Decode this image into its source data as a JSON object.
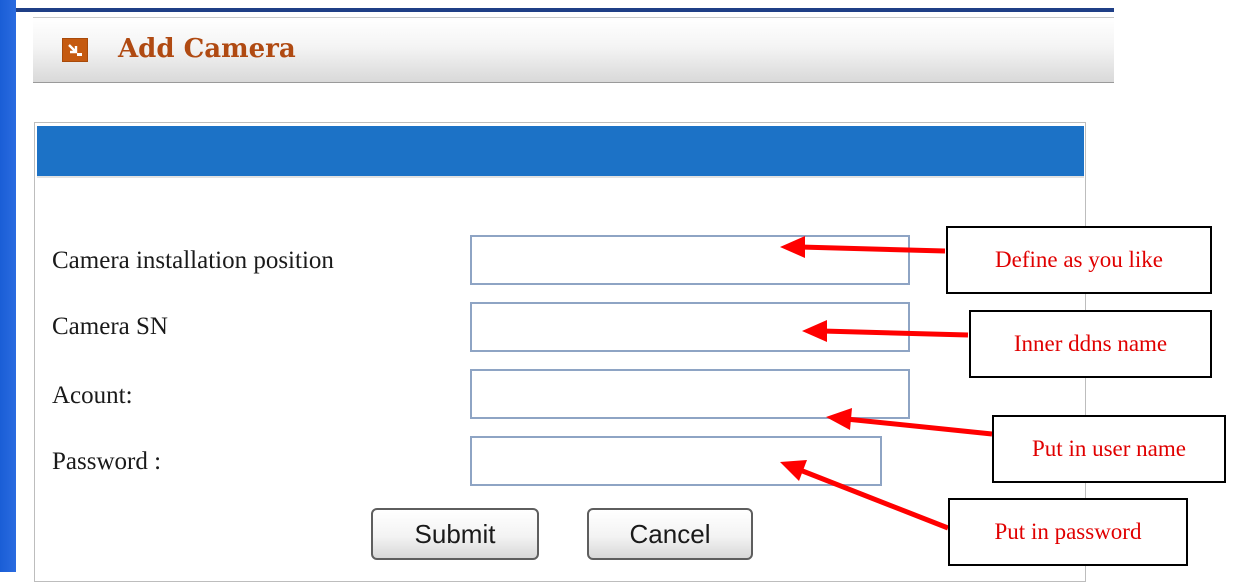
{
  "header": {
    "title": "Add Camera",
    "icon": "arrow-down-right-icon"
  },
  "form": {
    "fields": [
      {
        "label": "Camera installation position",
        "value": ""
      },
      {
        "label": "Camera SN",
        "value": ""
      },
      {
        "label": "Acount:",
        "value": ""
      },
      {
        "label": "Password :",
        "value": ""
      }
    ],
    "submit_label": "Submit",
    "cancel_label": "Cancel"
  },
  "annotations": [
    {
      "text": "Define as you like"
    },
    {
      "text": "Inner ddns name"
    },
    {
      "text": "Put in user name"
    },
    {
      "text": "Put in password"
    }
  ],
  "colors": {
    "panel_header": "#1c72c6",
    "title_text": "#b04a12",
    "annotation_text": "#e00000",
    "arrow": "#ff0000",
    "sidebar": "#1a5ed6"
  }
}
